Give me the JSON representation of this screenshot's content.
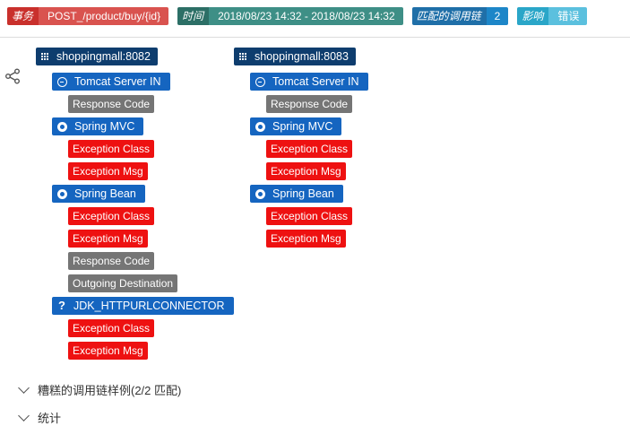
{
  "badges": [
    {
      "key": "事务",
      "value": "POST_/product/buy/{id}"
    },
    {
      "key": "时间",
      "value": "2018/08/23 14:32 - 2018/08/23 14:32"
    },
    {
      "key": "匹配的调用链",
      "value": "2"
    },
    {
      "key": "影响",
      "value": "错误"
    }
  ],
  "traces": [
    {
      "service": "shoppingmall:8082",
      "components": [
        {
          "name": "Tomcat Server IN",
          "icon": "enter-icon",
          "tags": [
            {
              "label": "Response Code",
              "type": "gray"
            }
          ]
        },
        {
          "name": "Spring MVC",
          "icon": "circle-dot-icon",
          "tags": [
            {
              "label": "Exception Class",
              "type": "error"
            },
            {
              "label": "Exception Msg",
              "type": "error"
            }
          ]
        },
        {
          "name": "Spring Bean",
          "icon": "circle-dot-icon",
          "tags": [
            {
              "label": "Exception Class",
              "type": "error"
            },
            {
              "label": "Exception Msg",
              "type": "error"
            },
            {
              "label": "Response Code",
              "type": "gray"
            },
            {
              "label": "Outgoing Destination",
              "type": "gray"
            }
          ]
        },
        {
          "name": "JDK_HTTPURLCONNECTOR",
          "icon": "question-icon",
          "tags": [
            {
              "label": "Exception Class",
              "type": "error"
            },
            {
              "label": "Exception Msg",
              "type": "error"
            }
          ]
        }
      ]
    },
    {
      "service": "shoppingmall:8083",
      "components": [
        {
          "name": "Tomcat Server IN",
          "icon": "enter-icon",
          "tags": [
            {
              "label": "Response Code",
              "type": "gray"
            }
          ]
        },
        {
          "name": "Spring MVC",
          "icon": "circle-dot-icon",
          "tags": [
            {
              "label": "Exception Class",
              "type": "error"
            },
            {
              "label": "Exception Msg",
              "type": "error"
            }
          ]
        },
        {
          "name": "Spring Bean",
          "icon": "circle-dot-icon",
          "tags": [
            {
              "label": "Exception Class",
              "type": "error"
            },
            {
              "label": "Exception Msg",
              "type": "error"
            }
          ]
        }
      ]
    }
  ],
  "sections": [
    {
      "label": "糟糕的调用链样例(2/2 匹配)"
    },
    {
      "label": "统计"
    }
  ],
  "colors": {
    "error": "#ee1111",
    "gray": "#757575",
    "component": "#1565c0",
    "service": "#0e3d6e"
  }
}
